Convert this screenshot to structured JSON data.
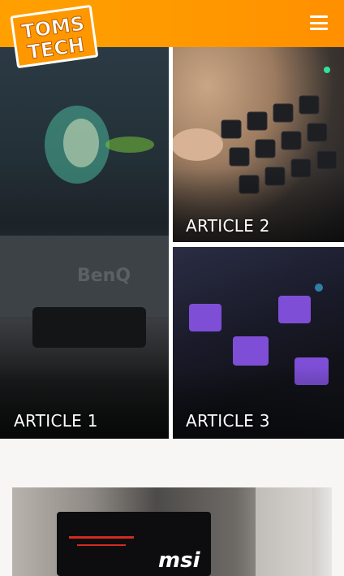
{
  "header": {
    "logo_text_line1": "TOMS",
    "logo_text_line2": "TECH",
    "menu_icon": "hamburger-menu-icon",
    "background": "#ff9800"
  },
  "articles": [
    {
      "label": "ARTICLE 1",
      "image_text": "BenQ"
    },
    {
      "label": "ARTICLE 2"
    },
    {
      "label": "ARTICLE 3"
    }
  ],
  "feature": {
    "image_text": "msi"
  }
}
